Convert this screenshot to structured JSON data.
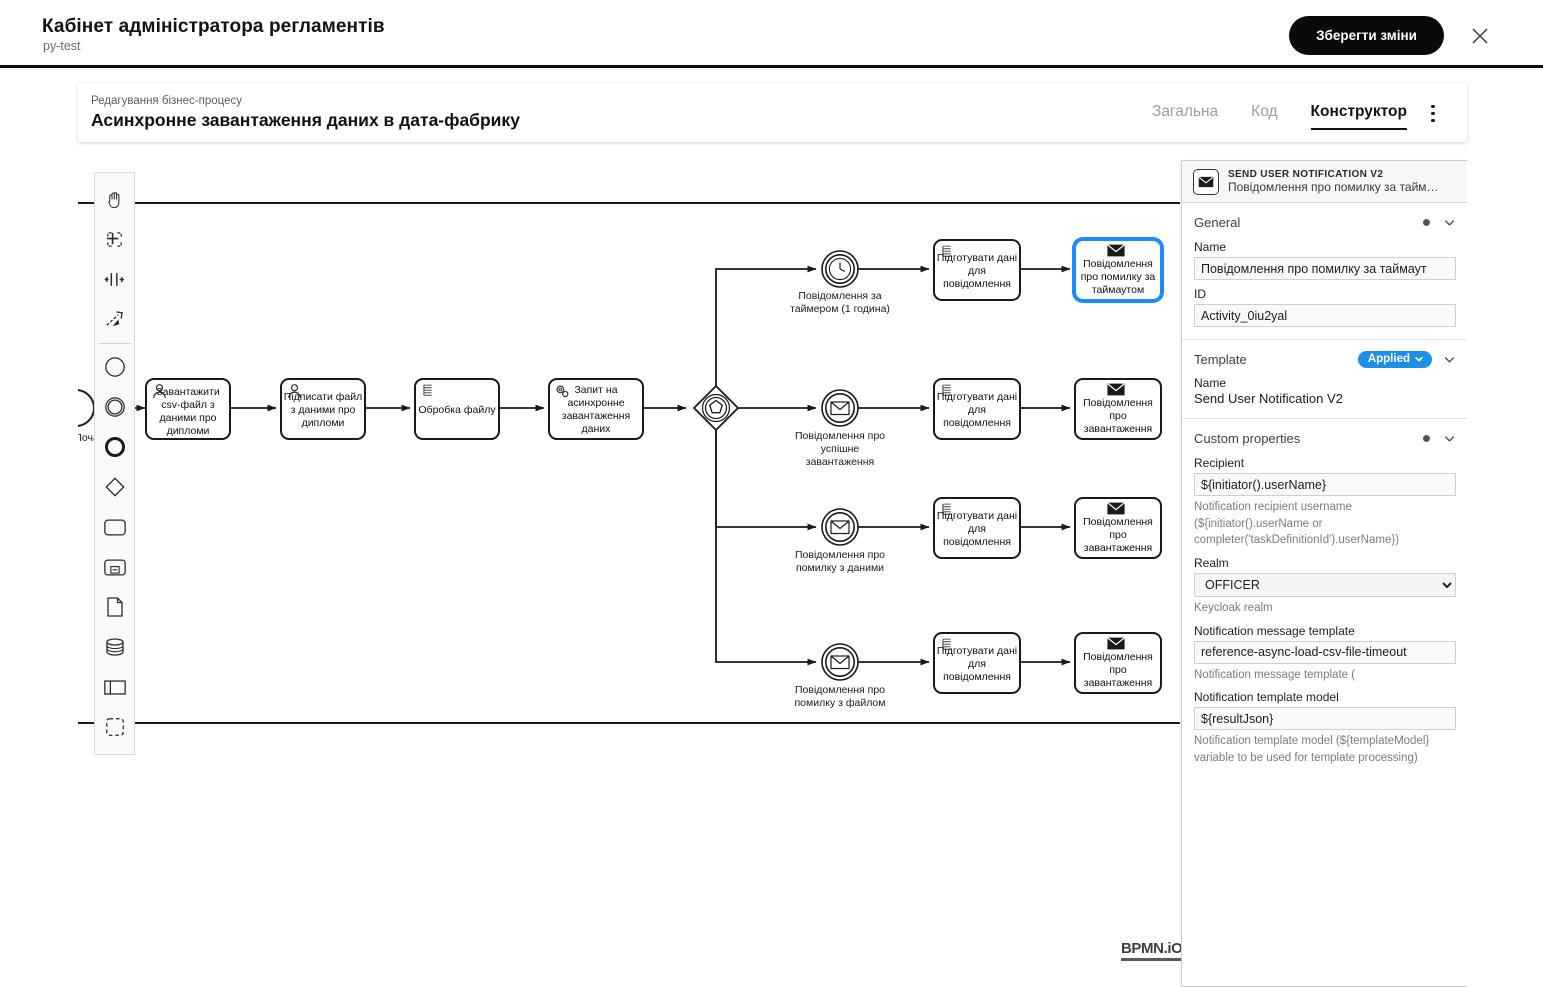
{
  "header": {
    "title": "Кабінет адміністратора регламентів",
    "subtitle": "py-test",
    "save_label": "Зберегти зміни",
    "close_icon": "close-icon"
  },
  "editor": {
    "breadcrumb": "Редагування бізнес-процесу",
    "process_title": "Асинхронне завантаження даних в дата-фабрику",
    "tabs": [
      {
        "label": "Загальна",
        "active": false
      },
      {
        "label": "Код",
        "active": false
      },
      {
        "label": "Конструктор",
        "active": true
      }
    ],
    "kebab_icon": "kebab-menu-icon"
  },
  "palette": {
    "items": [
      {
        "icon": "hand-tool-icon",
        "name": "activate-hand-tool"
      },
      {
        "icon": "lasso-tool-icon",
        "name": "activate-lasso-tool"
      },
      {
        "icon": "space-tool-icon",
        "name": "activate-space-tool"
      },
      {
        "icon": "global-connect-tool-icon",
        "name": "activate-global-connect-tool"
      },
      {
        "icon": "start-event-icon",
        "name": "create-start-event"
      },
      {
        "icon": "intermediate-event-icon",
        "name": "create-intermediate-event"
      },
      {
        "icon": "end-event-icon",
        "name": "create-end-event"
      },
      {
        "icon": "gateway-icon",
        "name": "create-gateway"
      },
      {
        "icon": "task-icon",
        "name": "create-task"
      },
      {
        "icon": "subprocess-icon",
        "name": "create-subprocess-expanded"
      },
      {
        "icon": "data-object-icon",
        "name": "create-data-object"
      },
      {
        "icon": "data-store-icon",
        "name": "create-data-store"
      },
      {
        "icon": "participant-icon",
        "name": "create-participant"
      },
      {
        "icon": "group-icon",
        "name": "create-group"
      }
    ]
  },
  "diagram": {
    "logo": "BPMN.iO",
    "start_event_label": "Початок",
    "tasks": [
      {
        "id": "t1",
        "label": "Завантажити csv-файл з даними про дипломи",
        "type": "user-task"
      },
      {
        "id": "t2",
        "label": "Підписати файл з даними про дипломи",
        "type": "user-task"
      },
      {
        "id": "t3",
        "label": "Обробка файлу",
        "type": "script-task"
      },
      {
        "id": "t4",
        "label": "Запит на асинхронне завантаження даних",
        "type": "service-task"
      },
      {
        "id": "p1",
        "label": "Підготувати дані для повідомлення",
        "type": "script-task"
      },
      {
        "id": "p2",
        "label": "Підготувати дані для повідомлення",
        "type": "script-task"
      },
      {
        "id": "p3",
        "label": "Підготувати дані для повідомлення",
        "type": "script-task"
      },
      {
        "id": "p4",
        "label": "Підготувати дані для повідомлення",
        "type": "script-task"
      },
      {
        "id": "m1",
        "label": "Повідомлення про помилку за таймаутом",
        "type": "send-task",
        "selected": true
      },
      {
        "id": "m2",
        "label": "Повідомлення про завантаження",
        "type": "send-task"
      },
      {
        "id": "m3",
        "label": "Повідомлення про завантаження",
        "type": "send-task"
      },
      {
        "id": "m4",
        "label": "Повідомлення про завантаження",
        "type": "send-task"
      }
    ],
    "events": [
      {
        "id": "e1",
        "label": "Повідомлення за таймером (1 година)",
        "type": "timer-event"
      },
      {
        "id": "e2",
        "label": "Повідомлення про успішне завантаження",
        "type": "message-event"
      },
      {
        "id": "e3",
        "label": "Повідомлення про помилку з даними",
        "type": "message-event"
      },
      {
        "id": "e4",
        "label": "Повідомлення про помилку з файлом",
        "type": "message-event"
      }
    ],
    "gateway": {
      "id": "g1",
      "type": "event-based-gateway"
    }
  },
  "properties": {
    "element_type": "Send User Notification V2",
    "element_name_short": "Повідомлення про помилку за тайм…",
    "icon": "envelope-icon",
    "groups": {
      "general": {
        "title": "General",
        "name_label": "Name",
        "name_value": "Повідомлення про помилку за таймаут",
        "id_label": "ID",
        "id_value": "Activity_0iu2yal"
      },
      "template": {
        "title": "Template",
        "badge": "Applied",
        "name_label": "Name",
        "name_value": "Send User Notification V2"
      },
      "custom": {
        "title": "Custom properties",
        "recipient_label": "Recipient",
        "recipient_value": "${initiator().userName}",
        "recipient_hint": "Notification recipient username (${initiator().userName or completer('taskDefinitionId').userName})",
        "realm_label": "Realm",
        "realm_value": "OFFICER",
        "realm_options": [
          "OFFICER"
        ],
        "realm_hint": "Keycloak realm",
        "msg_template_label": "Notification message template",
        "msg_template_value": "reference-async-load-csv-file-timeout",
        "msg_template_hint": "Notification message template (",
        "template_model_label": "Notification template model",
        "template_model_value": "${resultJson}",
        "template_model_hint": "Notification template model (${templateModel} variable to be used for template processing)"
      }
    }
  },
  "colors": {
    "accent_blue": "#1e8fe8",
    "selection_blue": "#1a8cff",
    "dark": "#0a0a0a"
  }
}
